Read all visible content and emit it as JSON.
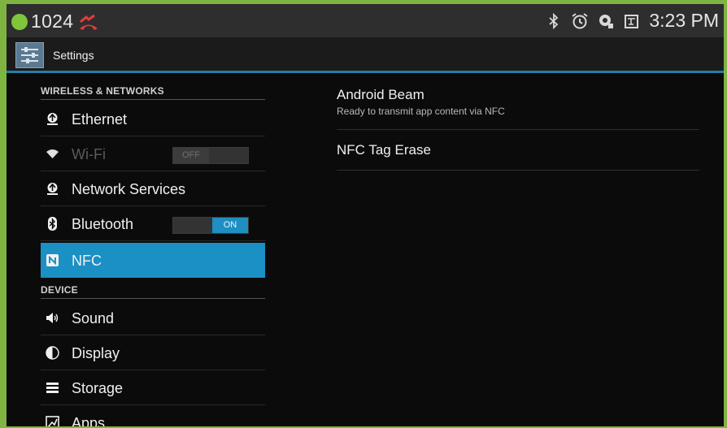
{
  "status_bar": {
    "notification_count": "1024",
    "time": "3:23 PM",
    "icons": [
      "notification-dot-icon",
      "missed-call-icon",
      "bluetooth-icon",
      "alarm-icon",
      "sync-icon",
      "sd-card-icon"
    ]
  },
  "action_bar": {
    "title": "Settings",
    "icon": "settings-icon"
  },
  "sidebar": {
    "sections": [
      {
        "header": "WIRELESS & NETWORKS",
        "items": [
          {
            "label": "Ethernet",
            "icon": "ethernet-icon",
            "enabled": true
          },
          {
            "label": "Wi-Fi",
            "icon": "wifi-icon",
            "enabled": false,
            "toggle": "OFF"
          },
          {
            "label": "Network Services",
            "icon": "network-services-icon",
            "enabled": true
          },
          {
            "label": "Bluetooth",
            "icon": "bluetooth-icon",
            "enabled": true,
            "toggle": "ON"
          },
          {
            "label": "NFC",
            "icon": "nfc-icon",
            "enabled": true,
            "selected": true
          }
        ]
      },
      {
        "header": "DEVICE",
        "items": [
          {
            "label": "Sound",
            "icon": "sound-icon"
          },
          {
            "label": "Display",
            "icon": "display-icon"
          },
          {
            "label": "Storage",
            "icon": "storage-icon"
          },
          {
            "label": "Apps",
            "icon": "apps-icon"
          }
        ]
      }
    ]
  },
  "detail": {
    "prefs": [
      {
        "title": "Android Beam",
        "summary": "Ready to transmit app content via NFC"
      },
      {
        "title": "NFC Tag Erase",
        "summary": ""
      }
    ]
  },
  "colors": {
    "accent": "#1a90c4",
    "frame_border": "#7fb442",
    "background": "#0b0b0b"
  }
}
